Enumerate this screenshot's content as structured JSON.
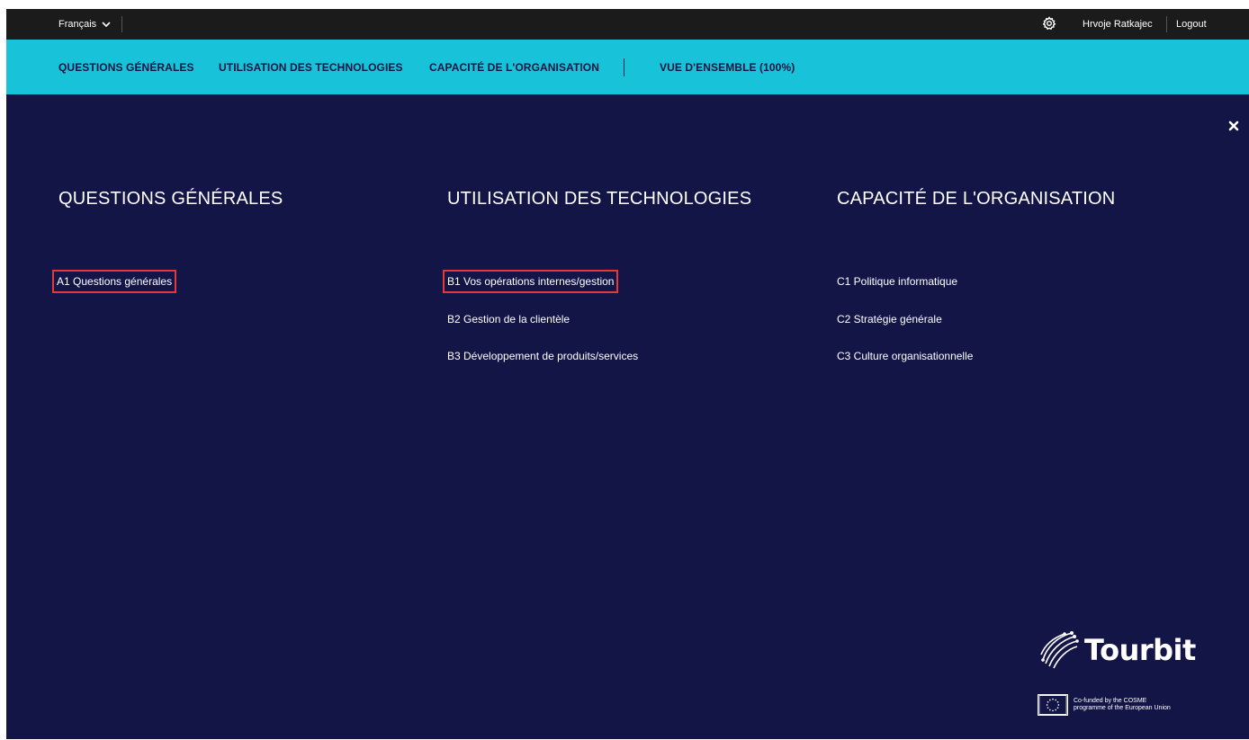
{
  "topbar": {
    "language": "Français",
    "user_name": "Hrvoje Ratkajec",
    "logout": "Logout"
  },
  "nav": {
    "items": [
      "QUESTIONS GÉNÉRALES",
      "UTILISATION DES TECHNOLOGIES",
      "CAPACITÉ DE L'ORGANISATION",
      "VUE D'ENSEMBLE (100%)"
    ]
  },
  "menu": {
    "columns": [
      {
        "title": "QUESTIONS GÉNÉRALES",
        "links": [
          "A1 Questions générales"
        ]
      },
      {
        "title": "UTILISATION DES TECHNOLOGIES",
        "links": [
          "B1 Vos opérations internes/gestion",
          "B2 Gestion de la clientèle",
          "B3 Développement de produits/services"
        ]
      },
      {
        "title": "CAPACITÉ DE L'ORGANISATION",
        "links": [
          "C1 Politique informatique",
          "C2 Stratégie générale",
          "C3 Culture organisationnelle"
        ]
      }
    ]
  },
  "footer": {
    "brand": "Tourbit",
    "cofunded": "Co-funded by the COSME programme of the European Union"
  },
  "colors": {
    "background": "#131547",
    "topbar": "#1b1b1b",
    "navbar": "#18c2d9",
    "highlight": "#e53935"
  },
  "icons": [
    "chevron-down-icon",
    "gear-icon",
    "close-icon",
    "tourbit-logo-icon",
    "eu-flag-icon"
  ]
}
